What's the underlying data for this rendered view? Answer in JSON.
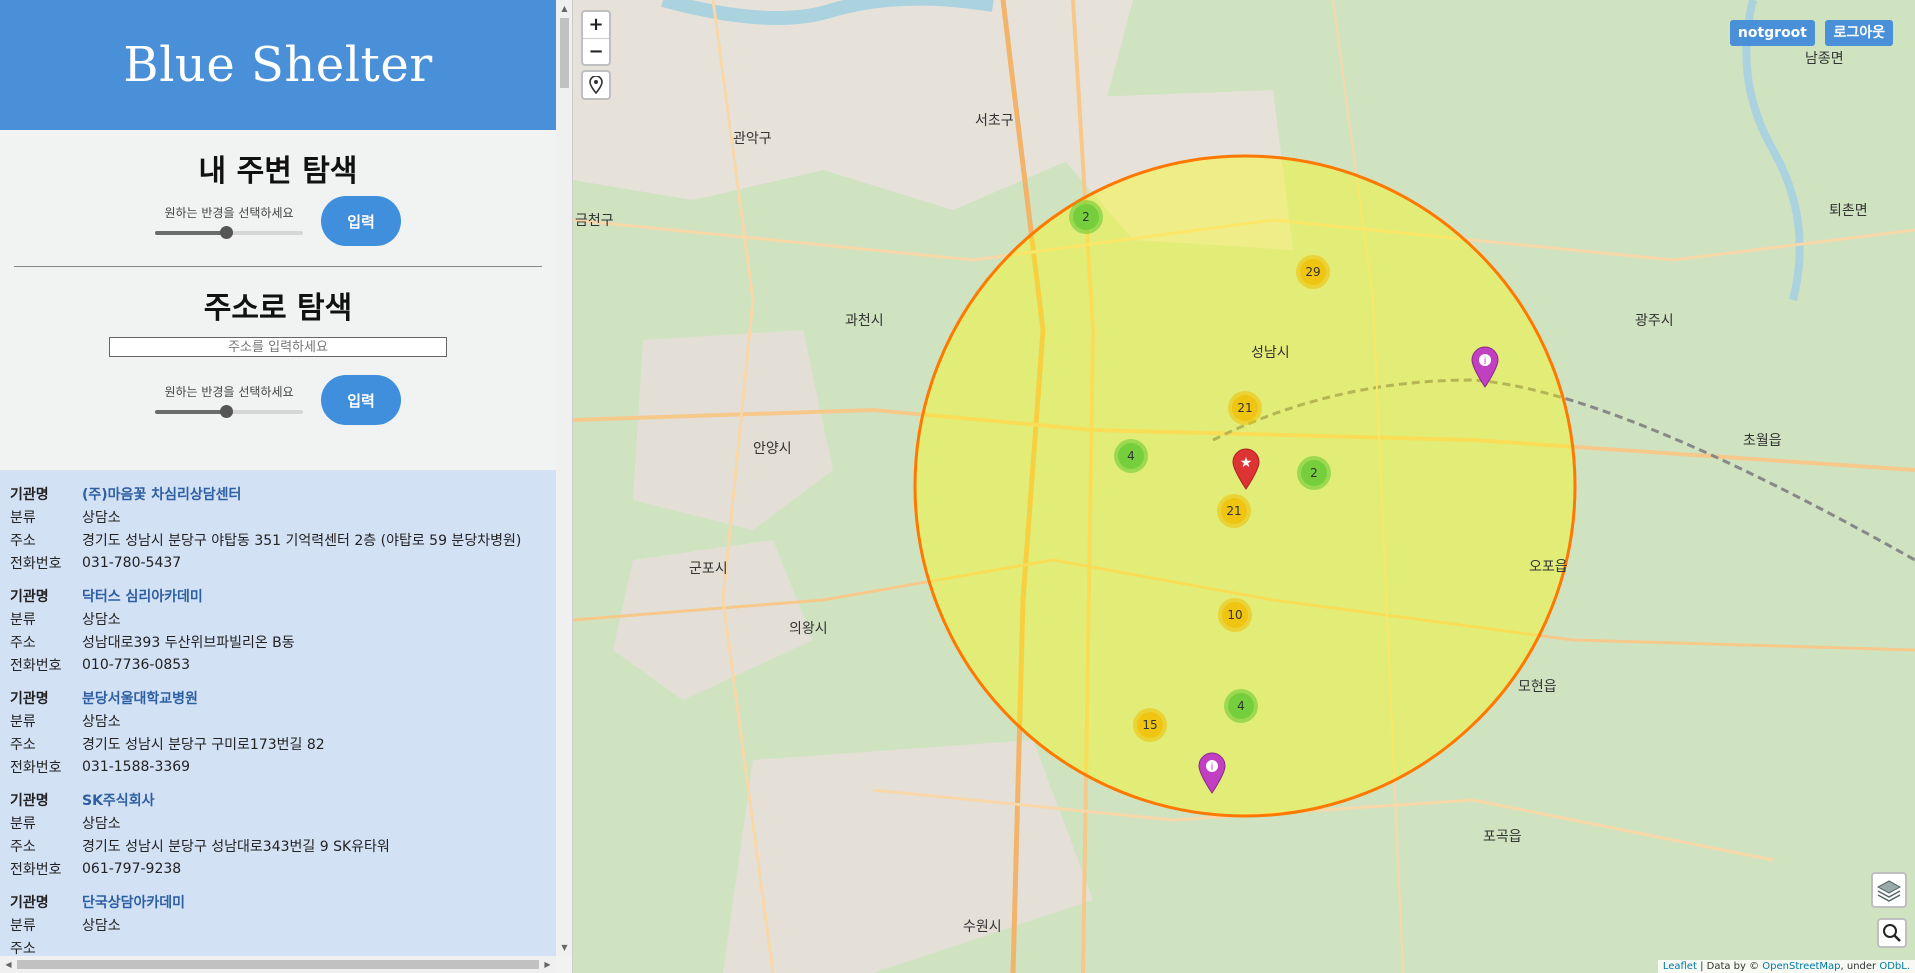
{
  "sidebar": {
    "brand": "Blue Shelter",
    "nearby": {
      "title": "내 주변 탐색",
      "radius_label": "원하는 반경을 선택하세요",
      "radius_value": 0.48,
      "submit": "입력"
    },
    "address": {
      "title": "주소로 탐색",
      "placeholder": "주소를 입력하세요",
      "radius_label": "원하는 반경을 선택하세요",
      "radius_value": 0.48,
      "submit": "입력"
    },
    "labels": {
      "name": "기관명",
      "category": "분류",
      "address": "주소",
      "phone": "전화번호"
    },
    "results": [
      {
        "name": "(주)마음꽃 차심리상담센터",
        "category": "상담소",
        "address": "경기도 성남시 분당구 야탑동 351 기억력센터 2층 (야탑로 59 분당차병원)",
        "phone": "031-780-5437"
      },
      {
        "name": "닥터스 심리아카데미",
        "category": "상담소",
        "address": "성남대로393 두산위브파빌리온 B동",
        "phone": "010-7736-0853"
      },
      {
        "name": "분당서울대학교병원",
        "category": "상담소",
        "address": "경기도 성남시 분당구 구미로173번길 82",
        "phone": "031-1588-3369"
      },
      {
        "name": "SK주식회사",
        "category": "상담소",
        "address": "경기도 성남시 분당구 성남대로343번길 9 SK유타워",
        "phone": "061-797-9238"
      },
      {
        "name": "단국상담아카데미",
        "category": "상담소",
        "address": "",
        "phone": ""
      }
    ]
  },
  "map": {
    "controls": {
      "zoom_in": "+",
      "zoom_out": "−"
    },
    "user": {
      "name": "notgroot",
      "logout": "로그아웃"
    },
    "clusters": [
      {
        "count": "2",
        "size": "small"
      },
      {
        "count": "29",
        "size": "medium"
      },
      {
        "count": "21",
        "size": "medium"
      },
      {
        "count": "4",
        "size": "small"
      },
      {
        "count": "2",
        "size": "small"
      },
      {
        "count": "21",
        "size": "medium"
      },
      {
        "count": "10",
        "size": "medium"
      },
      {
        "count": "4",
        "size": "small"
      },
      {
        "count": "15",
        "size": "medium"
      }
    ],
    "places": [
      "서초구",
      "관악구",
      "과천시",
      "안양시",
      "군포시",
      "의왕시",
      "성남시",
      "광주시",
      "수원시",
      "금천구",
      "초월읍",
      "오포읍",
      "포곡읍",
      "퇴촌면",
      "남종면",
      "모현읍"
    ],
    "attribution": {
      "leaflet": "Leaflet",
      "data": " | Data by © ",
      "osm": "OpenStreetMap",
      "under": ", under ",
      "odbl": "ODbL."
    },
    "colors": {
      "radius_stroke": "#ff7800",
      "radius_fill": "#ffff00",
      "brand": "#4a90d9"
    }
  }
}
